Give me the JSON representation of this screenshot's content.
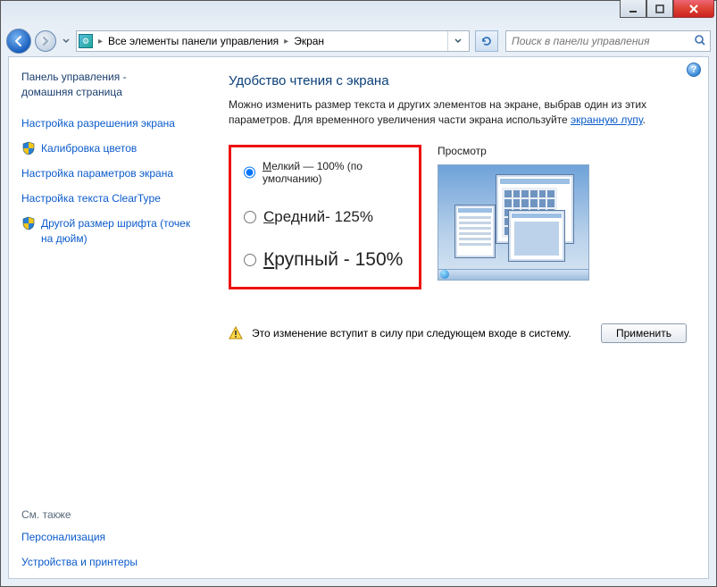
{
  "titlebar": {
    "minimize": "–",
    "maximize": "□",
    "close": "✕"
  },
  "nav": {
    "breadcrumb_root": "Все элементы панели управления",
    "breadcrumb_leaf": "Экран",
    "search_placeholder": "Поиск в панели управления"
  },
  "sidebar": {
    "home_line1": "Панель управления -",
    "home_line2": "домашняя страница",
    "links": [
      "Настройка разрешения экрана",
      "Калибровка цветов",
      "Настройка параметров экрана",
      "Настройка текста ClearType",
      "Другой размер шрифта (точек на дюйм)"
    ],
    "seealso_header": "См. также",
    "seealso_links": [
      "Персонализация",
      "Устройства и принтеры"
    ]
  },
  "main": {
    "title": "Удобство чтения с экрана",
    "desc_part1": "Можно изменить размер текста и других элементов на экране, выбрав один из этих параметров. Для временного увеличения части экрана используйте ",
    "desc_link": "экранную лупу",
    "desc_part2": ".",
    "options": [
      {
        "label_pre": "М",
        "label_rest": "елкий — 100% (по умолчанию)",
        "checked": true,
        "size": "sz1"
      },
      {
        "label_pre": "С",
        "label_rest": "редний- 125%",
        "checked": false,
        "size": "sz2"
      },
      {
        "label_pre": "К",
        "label_rest": "рупный - 150%",
        "checked": false,
        "size": "sz3"
      }
    ],
    "preview_label": "Просмотр",
    "notice": "Это изменение вступит в силу при следующем входе в систему.",
    "apply": "Применить"
  }
}
